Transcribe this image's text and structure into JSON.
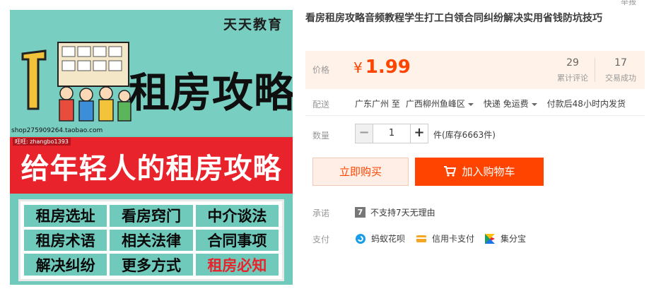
{
  "product_image": {
    "brand": "天天教育",
    "big_title": "租房攻略",
    "shop_url": "shop275909264.taobao.com",
    "wangwang": "旺旺: zhangbo1393",
    "band_text": "给年轻人的租房攻略",
    "grid": [
      "租房选址",
      "看房窍门",
      "中介谈法",
      "租房术语",
      "相关法律",
      "合同事项",
      "解决纠纷",
      "更多方式",
      "租房必知"
    ],
    "illustration_icon": "cartoon-house-hunting-illustration"
  },
  "product": {
    "title": "看房租房攻略音频教程学生打工白领合同纠纷解决实用省钱防坑技巧",
    "corner_tag": "举报"
  },
  "price": {
    "label": "价格",
    "currency": "¥",
    "amount": "1.99",
    "color": "#ff4400"
  },
  "stats": {
    "reviews_count": "29",
    "reviews_label": "累计评论",
    "deals_count": "17",
    "deals_label": "交易成功"
  },
  "shipping": {
    "label": "配送",
    "from": "广东广州 至",
    "to": "广西柳州鱼峰区",
    "method": "快递 免运费",
    "note": "付款后48小时内发货"
  },
  "quantity": {
    "label": "数量",
    "value": "1",
    "minus": "−",
    "plus": "+",
    "stock": "件(库存6663件)"
  },
  "actions": {
    "buy_now": "立即购买",
    "add_to_cart": "加入购物车",
    "accent": "#ff4400"
  },
  "promise": {
    "label": "承诺",
    "badge": "7",
    "text": "不支持7天无理由"
  },
  "payment": {
    "label": "支付",
    "methods": [
      "蚂蚁花呗",
      "信用卡支付",
      "集分宝"
    ]
  }
}
